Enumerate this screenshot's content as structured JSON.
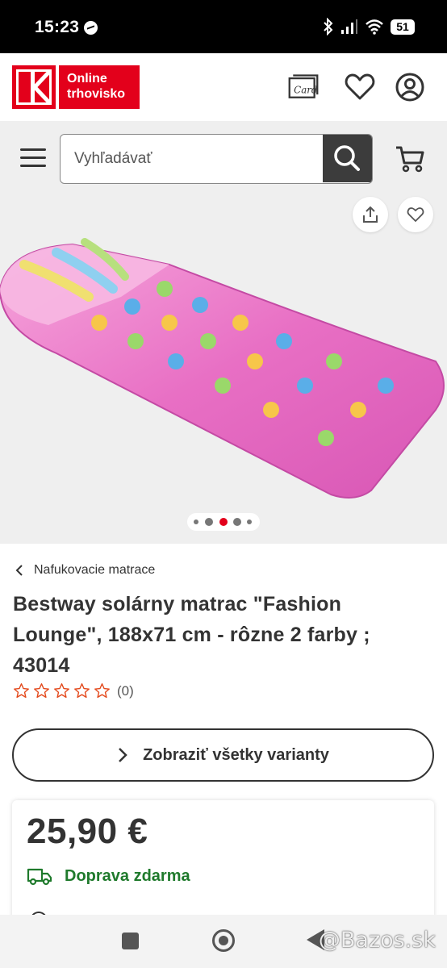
{
  "status_bar": {
    "time": "15:23",
    "battery": "51"
  },
  "header": {
    "logo_text": "Online trhovisko",
    "card_icon_text": "Card"
  },
  "search": {
    "placeholder": "Vyhľadávať"
  },
  "gallery": {
    "dot_count": 5,
    "active_dot_index": 2
  },
  "breadcrumb": {
    "label": "Nafukovacie matrace"
  },
  "product": {
    "title": "Bestway solárny matrac \"Fashion Lounge\", 188x71 cm - rôzne 2 farby ; 43014",
    "rating_stars": 0,
    "rating_max": 5,
    "rating_count": "(0)",
    "variants_label": "Zobraziť všetky varianty",
    "price": "25,90 €",
    "shipping": "Doprava zdarma"
  },
  "watermark": "@Bazos.sk",
  "colors": {
    "brand_red": "#e3001b",
    "shipping_green": "#1f7a2c",
    "active_dot": "#e3001b",
    "star_outline": "#e3481b"
  }
}
